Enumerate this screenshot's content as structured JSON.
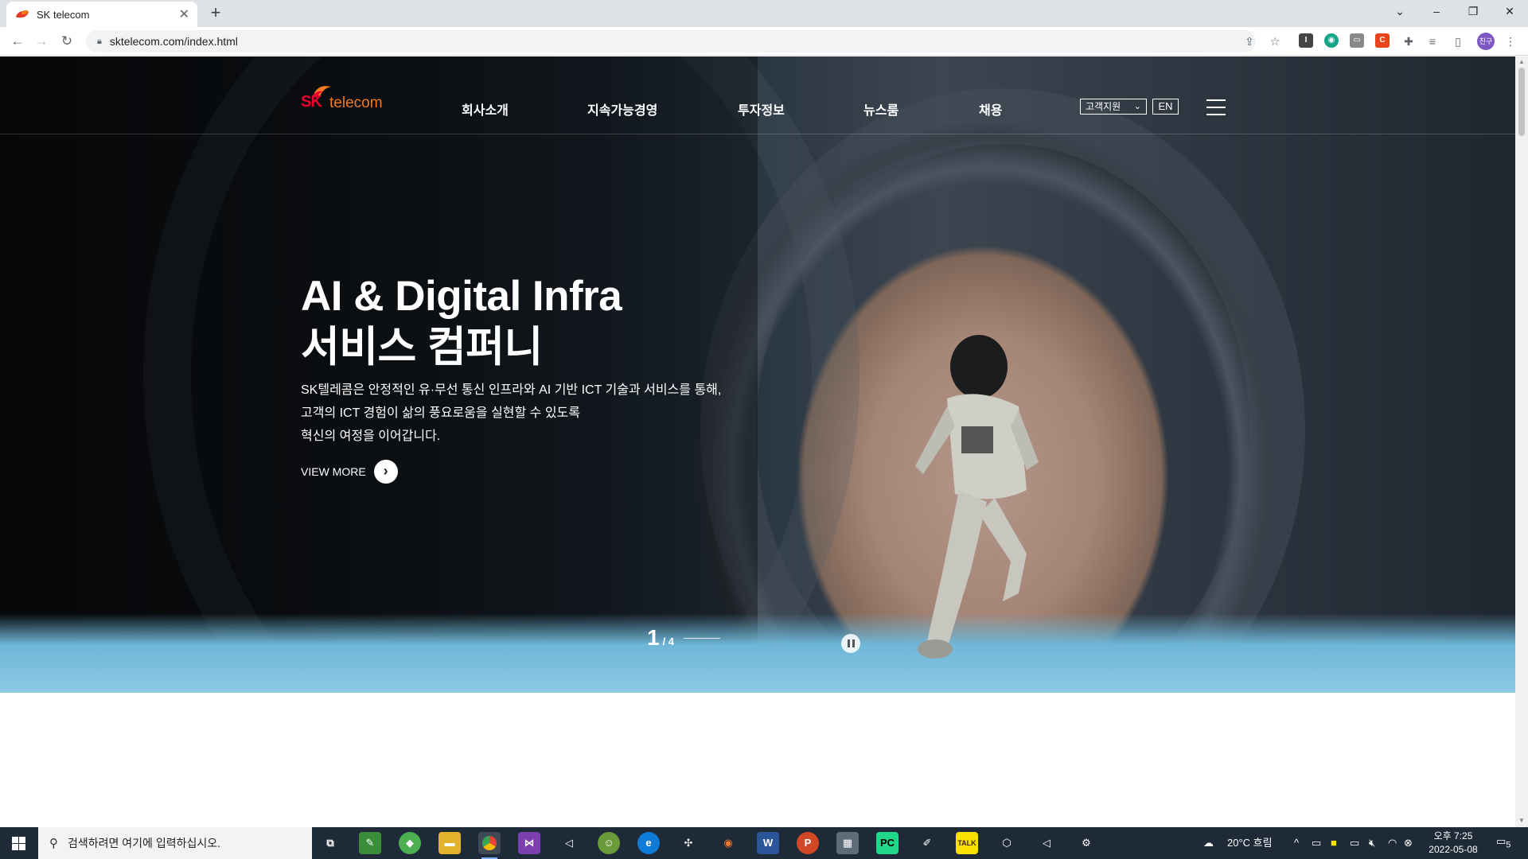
{
  "browser": {
    "tab_title": "SK telecom",
    "tab_close": "✕",
    "new_tab": "+",
    "url": "sktelecom.com/index.html",
    "window_controls": [
      "⌄",
      "–",
      "❐",
      "✕"
    ],
    "profile_label": "친구"
  },
  "site": {
    "logo": {
      "sk": "SK",
      "telecom": "telecom"
    },
    "nav": [
      "회사소개",
      "지속가능경영",
      "투자정보",
      "뉴스룸",
      "채용"
    ],
    "customer_support": "고객지원",
    "lang": "EN"
  },
  "hero": {
    "headline_line1": "AI & Digital Infra",
    "headline_line2": "서비스 컴퍼니",
    "desc_line1": "SK텔레콤은 안정적인 유·무선 통신 인프라와 AI 기반 ICT 기술과 서비스를 통해,",
    "desc_line2": "고객의 ICT 경험이 삶의 풍요로움을 실현할 수 있도록",
    "desc_line3": "혁신의 여정을 이어갑니다.",
    "view_more": "VIEW MORE",
    "pager_current": "1",
    "pager_total": "/ 4"
  },
  "taskbar": {
    "search_placeholder": "검색하려면 여기에 입력하십시오.",
    "weather": "20°C  흐림",
    "time": "오후 7:25",
    "date": "2022-05-08",
    "notification_count": "5"
  },
  "colors": {
    "sk_red": "#ea002c",
    "sk_orange": "#f47920",
    "taskbar_bg": "#1f2a38"
  }
}
